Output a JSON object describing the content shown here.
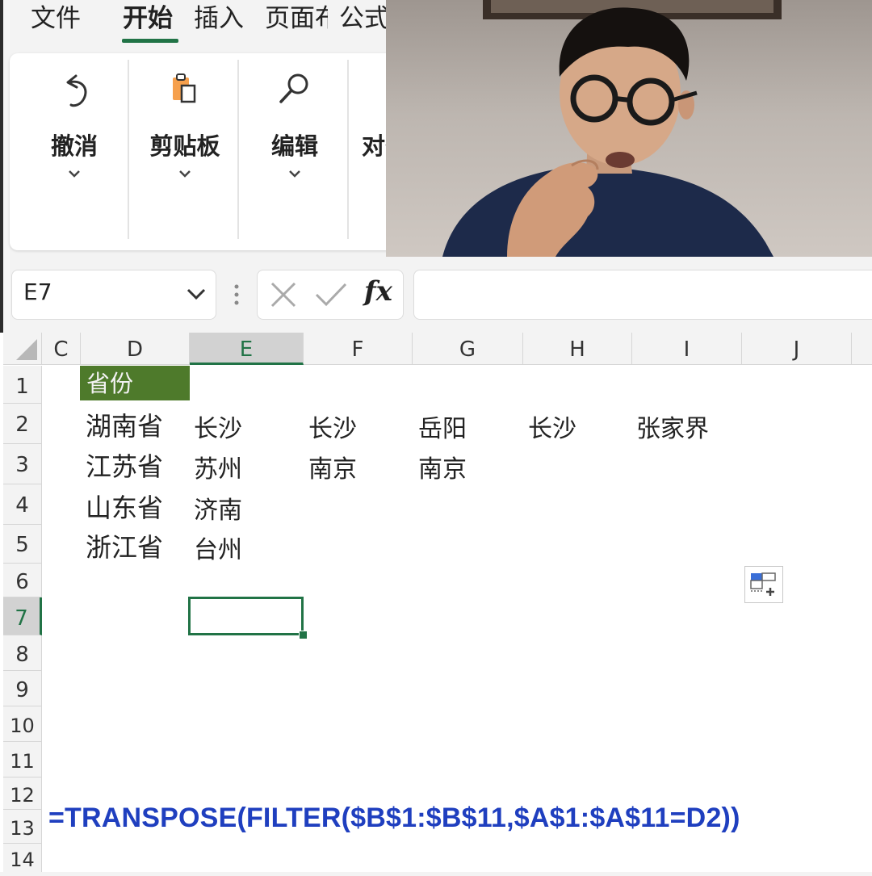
{
  "menu": {
    "tabs": [
      {
        "label": "文件",
        "active": false
      },
      {
        "label": "开始",
        "active": true
      },
      {
        "label": "插入",
        "active": false
      },
      {
        "label": "页面布局",
        "active": false
      },
      {
        "label": "公式",
        "active": false
      }
    ]
  },
  "ribbon": {
    "groups": [
      {
        "label": "撤消",
        "icon": "undo-icon"
      },
      {
        "label": "剪贴板",
        "icon": "clipboard-icon"
      },
      {
        "label": "编辑",
        "icon": "search-icon"
      },
      {
        "label": "对齐方式",
        "icon": "align-icon"
      }
    ]
  },
  "formula_bar": {
    "name_box": "E7",
    "fx_label": "fx",
    "formula": ""
  },
  "sheet": {
    "columns": [
      "C",
      "D",
      "E",
      "F",
      "G",
      "H",
      "I",
      "J"
    ],
    "selected_column": "E",
    "rows": [
      "1",
      "2",
      "3",
      "4",
      "5",
      "6",
      "7",
      "8",
      "9",
      "10",
      "11",
      "12",
      "13",
      "14"
    ],
    "selected_row": "7",
    "header_cell": "省份",
    "data": [
      {
        "province": "湖南省",
        "cities": [
          "长沙",
          "长沙",
          "岳阳",
          "长沙",
          "张家界"
        ]
      },
      {
        "province": "江苏省",
        "cities": [
          "苏州",
          "南京",
          "南京"
        ]
      },
      {
        "province": "山东省",
        "cities": [
          "济南"
        ]
      },
      {
        "province": "浙江省",
        "cities": [
          "台州"
        ]
      }
    ],
    "formula_note": "=TRANSPOSE(FILTER($B$1:$B$11,$A$1:$A$11=D2))"
  },
  "colors": {
    "accent": "#217346",
    "header_fill": "#4e7a2b",
    "formula_text": "#1f3fbf"
  }
}
